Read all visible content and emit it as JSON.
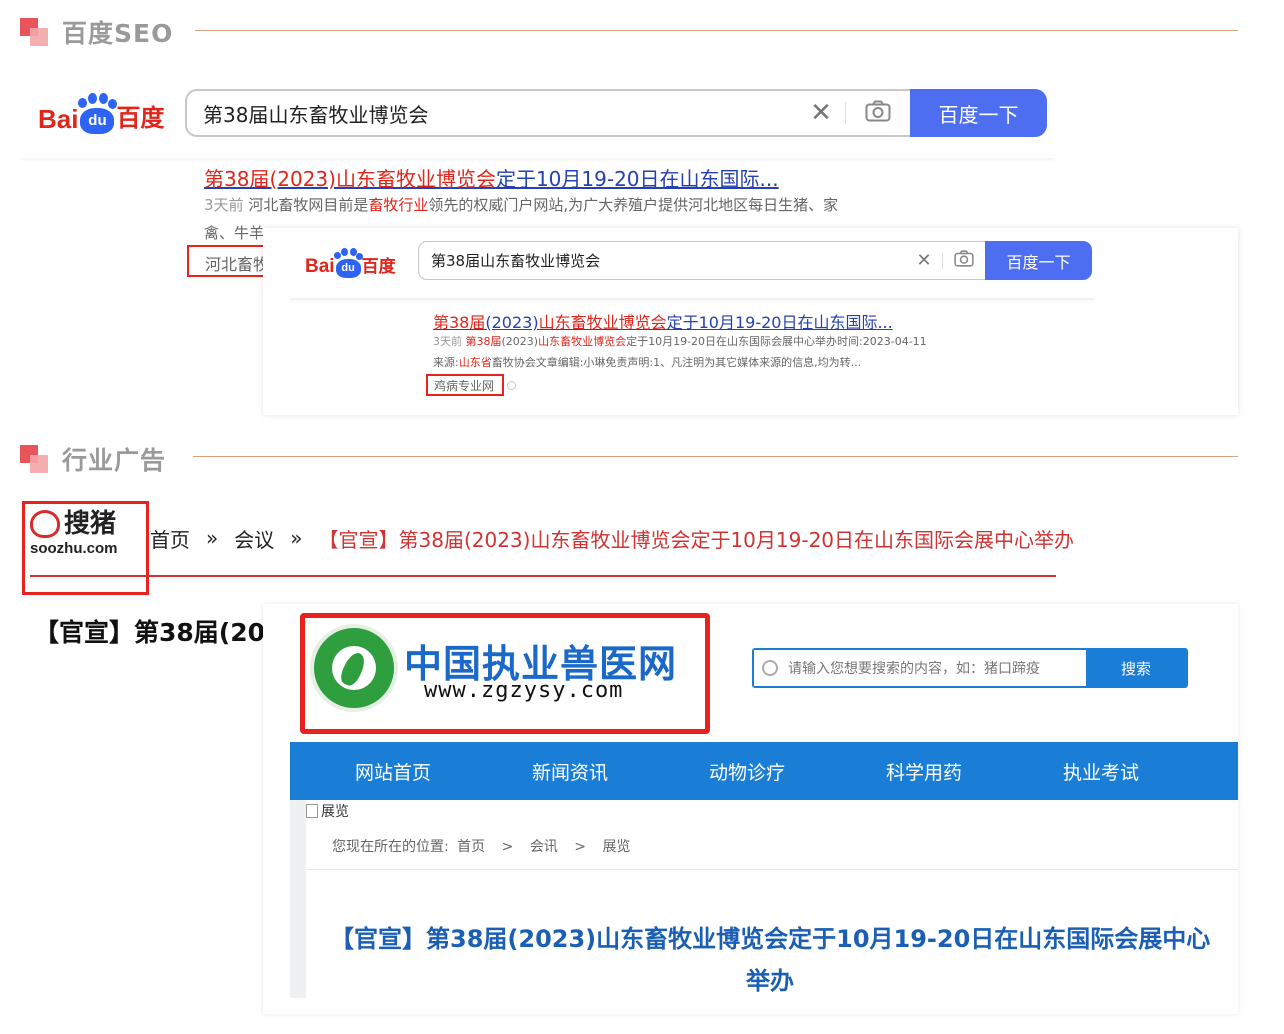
{
  "sections": {
    "baidu_seo": "百度SEO",
    "industry_ads": "行业广告"
  },
  "baidu_logo": {
    "bai": "Bai",
    "du": "du",
    "cn": "百度"
  },
  "baidu_large": {
    "query": "第38届山东畜牧业博览会",
    "button": "百度一下",
    "result_title_hl": "第38届(2023)山东畜牧业博览会",
    "result_title_rest": "定于10月19-20日在山东国际...",
    "meta_time": "3天前",
    "meta_a": "河北畜牧网目前是",
    "meta_hl": "畜牧行业",
    "meta_b": "领先的权威门户网站,为广大养殖户提供河北地区每日生猪、家",
    "meta_line2": "禽、牛羊",
    "source": "河北畜牧"
  },
  "baidu_small": {
    "query": "第38届山东畜牧业博览会",
    "button": "百度一下",
    "title_hl1": "第38届",
    "title_plain1": "(2023)",
    "title_hl2": "山东畜牧业博览会",
    "title_rest": "定于10月19-20日在山东国际...",
    "m1_time": "3天前",
    "m1_hl1": "第38届",
    "m1_plain": "(2023)",
    "m1_hl2": "山东畜牧业博览会",
    "m1_rest": "定于10月19-20日在山东国际会展中心举办时间:2023-04-11",
    "m2_a": "来源:",
    "m2_hl": "山东省",
    "m2_b": "畜牧协会文章编辑:小琳免责声明:1、凡注明为其它媒体来源的信息,均为转...",
    "source": "鸡病专业网"
  },
  "soozhu": {
    "logo_cn": "搜猪",
    "logo_en": "soozhu.com",
    "breadcrumb_home": "首页",
    "sep": "»",
    "breadcrumb_meeting": "会议",
    "breadcrumb_title": "【官宣】第38届(2023)山东畜牧业博览会定于10月19-20日在山东国际会展中心举办",
    "article_title_partial": "【官宣】第38届(20"
  },
  "zgzysy": {
    "site_name": "中国执业兽医网",
    "site_url": "www.zgzysy.com",
    "search_placeholder": "请输入您想要搜索的内容，如：猪口蹄疫",
    "search_button": "搜索",
    "nav": [
      "网站首页",
      "新闻资讯",
      "动物诊疗",
      "科学用药",
      "执业考试"
    ],
    "broken_image_alt": "展览",
    "location_label": "您现在所在的位置:",
    "crumb_home": "首页",
    "crumb_sep": ">",
    "crumb_news": "会讯",
    "crumb_exhibit": "展览",
    "article_title_line1": "【官宣】第38届(2023)山东畜牧业博览会定于10月19-20日在山东国际会展中心",
    "article_title_line2": "举办"
  },
  "colors": {
    "baidu_blue": "#4e6ef2",
    "baidu_red": "#e1251b",
    "link_blue": "#2440b3",
    "nav_blue": "#1a7dd6",
    "title_blue": "#1a5fb4",
    "highlight_box": "#e8221c"
  }
}
